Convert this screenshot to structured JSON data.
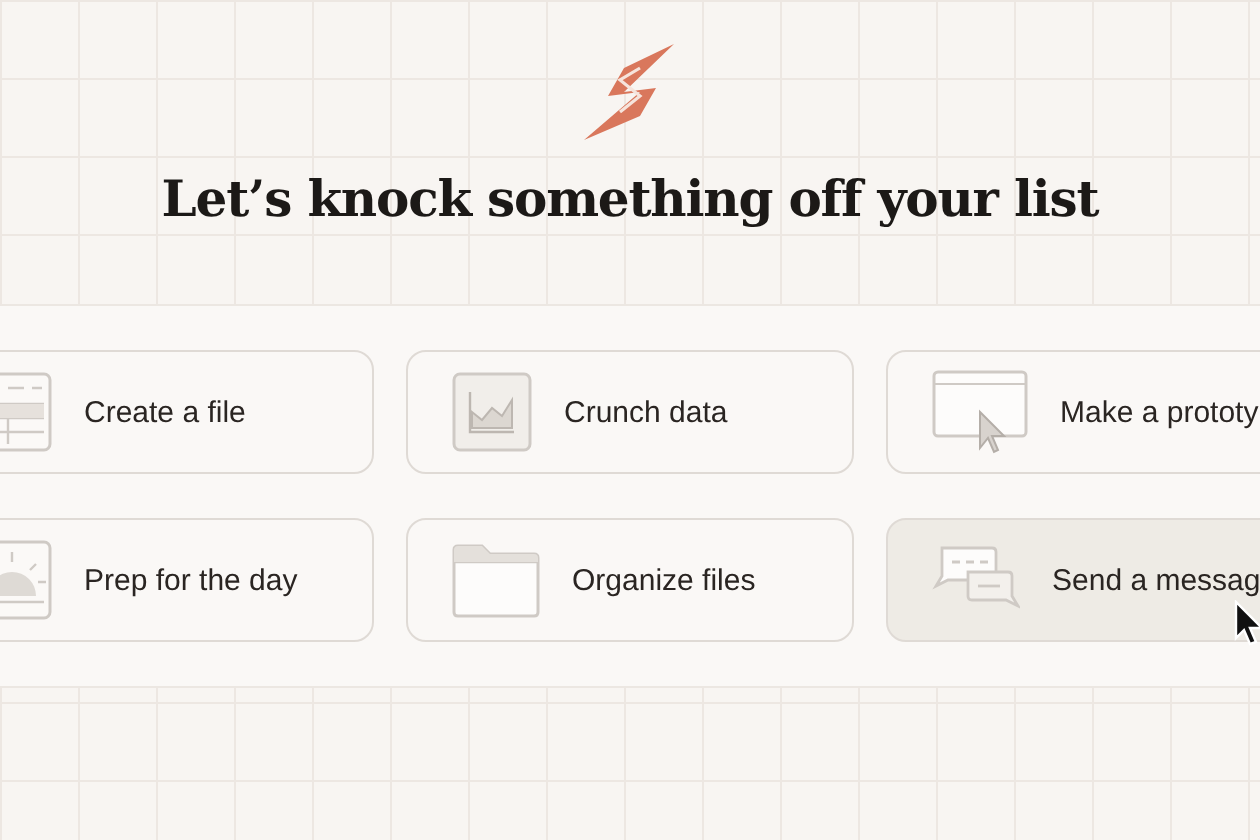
{
  "heading": "Let’s knock something off your list",
  "actions": [
    {
      "kind": "spreadsheet",
      "label": "Create a file",
      "hovered": false
    },
    {
      "kind": "chart",
      "label": "Crunch data",
      "hovered": false
    },
    {
      "kind": "prototype",
      "label": "Make a prototy",
      "hovered": false
    },
    {
      "kind": "sunrise",
      "label": "Prep for the day",
      "hovered": false
    },
    {
      "kind": "folder",
      "label": "Organize files",
      "hovered": false
    },
    {
      "kind": "messages",
      "label": "Send a messag",
      "hovered": true
    }
  ]
}
